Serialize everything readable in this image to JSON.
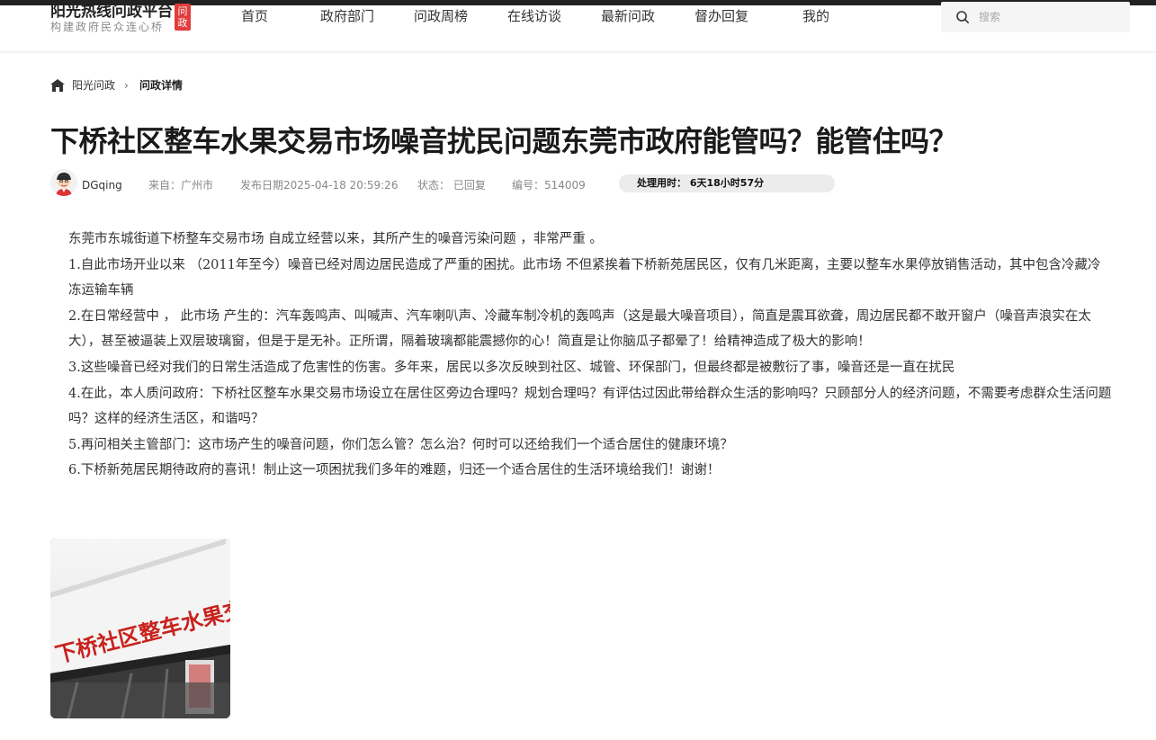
{
  "header": {
    "logo_title": "阳光热线问政平台",
    "logo_subtitle": "构建政府民众连心桥",
    "logo_badge": "问政",
    "nav": [
      {
        "label": "首页"
      },
      {
        "label": "政府部门"
      },
      {
        "label": "问政周榜"
      },
      {
        "label": "在线访谈"
      },
      {
        "label": "最新问政"
      },
      {
        "label": "督办回复"
      },
      {
        "label": "我的"
      }
    ],
    "search": {
      "placeholder": "搜索",
      "value": ""
    }
  },
  "breadcrumb": {
    "home_label": "阳光问政",
    "separator": "›",
    "current": "问政详情"
  },
  "article": {
    "title": "下桥社区整车水果交易市场噪音扰民问题东莞市政府能管吗？能管住吗？",
    "meta": {
      "user": "DGqing",
      "source": "来自：广州市",
      "publish_date": "发布日期2025-04-18 20:59:26",
      "status": "状态：  已回复",
      "number": "编号：514009",
      "duration": "处理用时：  6天18小时57分"
    },
    "paragraphs": [
      "东莞市东城街道下桥整车交易市场   自成立经营以来，其所产生的噪音污染问题 ，非常严重   。",
      "1.自此市场开业以来  （2011年至今）噪音已经对周边居民造成了严重的困扰。此市场   不但紧挨着下桥新苑居民区，仅有几米距离，主要以整车水果停放销售活动，其中包含冷藏冷冻运输车辆",
      "2.在日常经营中 ， 此市场 产生的：汽车轰鸣声、叫喊声、汽车喇叭声、冷藏车制冷机的轰鸣声（这是最大噪音项目），简直是震耳欲聋，周边居民都不敢开窗户（噪音声浪实在太大），甚至被逼装上双层玻璃窗，但是于是无补。正所谓，隔着玻璃都能震撼你的心！简直是让你脑瓜子都晕了！给精神造成了极大的影响！",
      "3.这些噪音已经对我们的日常生活造成了危害性的伤害。多年来，居民以多次反映到社区、城管、环保部门，但最终都是被敷衍了事，噪音还是一直在扰民",
      "4.在此，本人质问政府：下桥社区整车水果交易市场设立在居住区旁边合理吗？规划合理吗？有评估过因此带给群众生活的影响吗？只顾部分人的经济问题，不需要考虑群众生活问题吗？这样的经济生活区，和谐吗？",
      "5.再问相关主管部门：这市场产生的噪音问题，你们怎么管？怎么治？何时可以还给我们一个适合居住的健康环境？",
      "6.下桥新苑居民期待政府的喜讯！制止这一项困扰我们多年的难题，归还一个适合居住的生活环境给我们！谢谢！"
    ],
    "photo": {
      "sign_text": "下桥社区整车水果交易场"
    }
  }
}
